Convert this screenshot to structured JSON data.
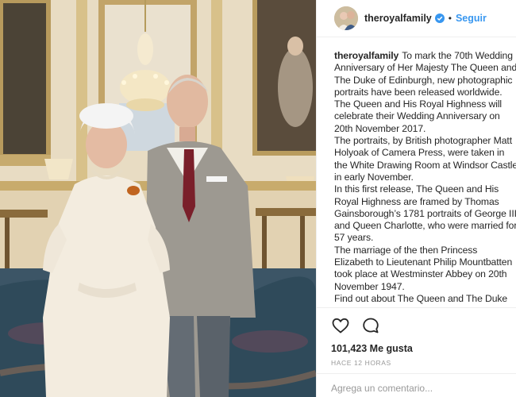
{
  "post": {
    "username": "theroyalfamily",
    "separator": "•",
    "follow_label": "Seguir",
    "caption": [
      "To mark the 70th Wedding Anniversary of Her Majesty The Queen and The Duke of Edinburgh, new photographic portraits have been released worldwide.",
      "The Queen and His Royal Highness will celebrate their Wedding Anniversary on 20th November 2017.",
      "The portraits, by British photographer Matt Holyoak of Camera Press, were taken in the White Drawing Room at Windsor Castle in early November.",
      "In this first release, The Queen and His Royal Highness are framed by Thomas Gainsborough’s 1781 portraits of George III and Queen Charlotte, who were married for 57 years.",
      "The marriage of the then Princess Elizabeth to Lieutenant Philip Mountbatten took place at Westminster Abbey on 20th November 1947.",
      "Find out about The Queen and The Duke"
    ],
    "likes": "101,423 Me gusta",
    "timestamp": "HACE 12 HORAS",
    "comment_placeholder": "Agrega un comentario..."
  },
  "icons": {
    "like": "heart-icon",
    "comment": "comment-icon",
    "verified": "verified-badge-icon"
  },
  "colors": {
    "link": "#3897f0",
    "text": "#262626",
    "muted": "#999999",
    "border": "#efefef"
  }
}
